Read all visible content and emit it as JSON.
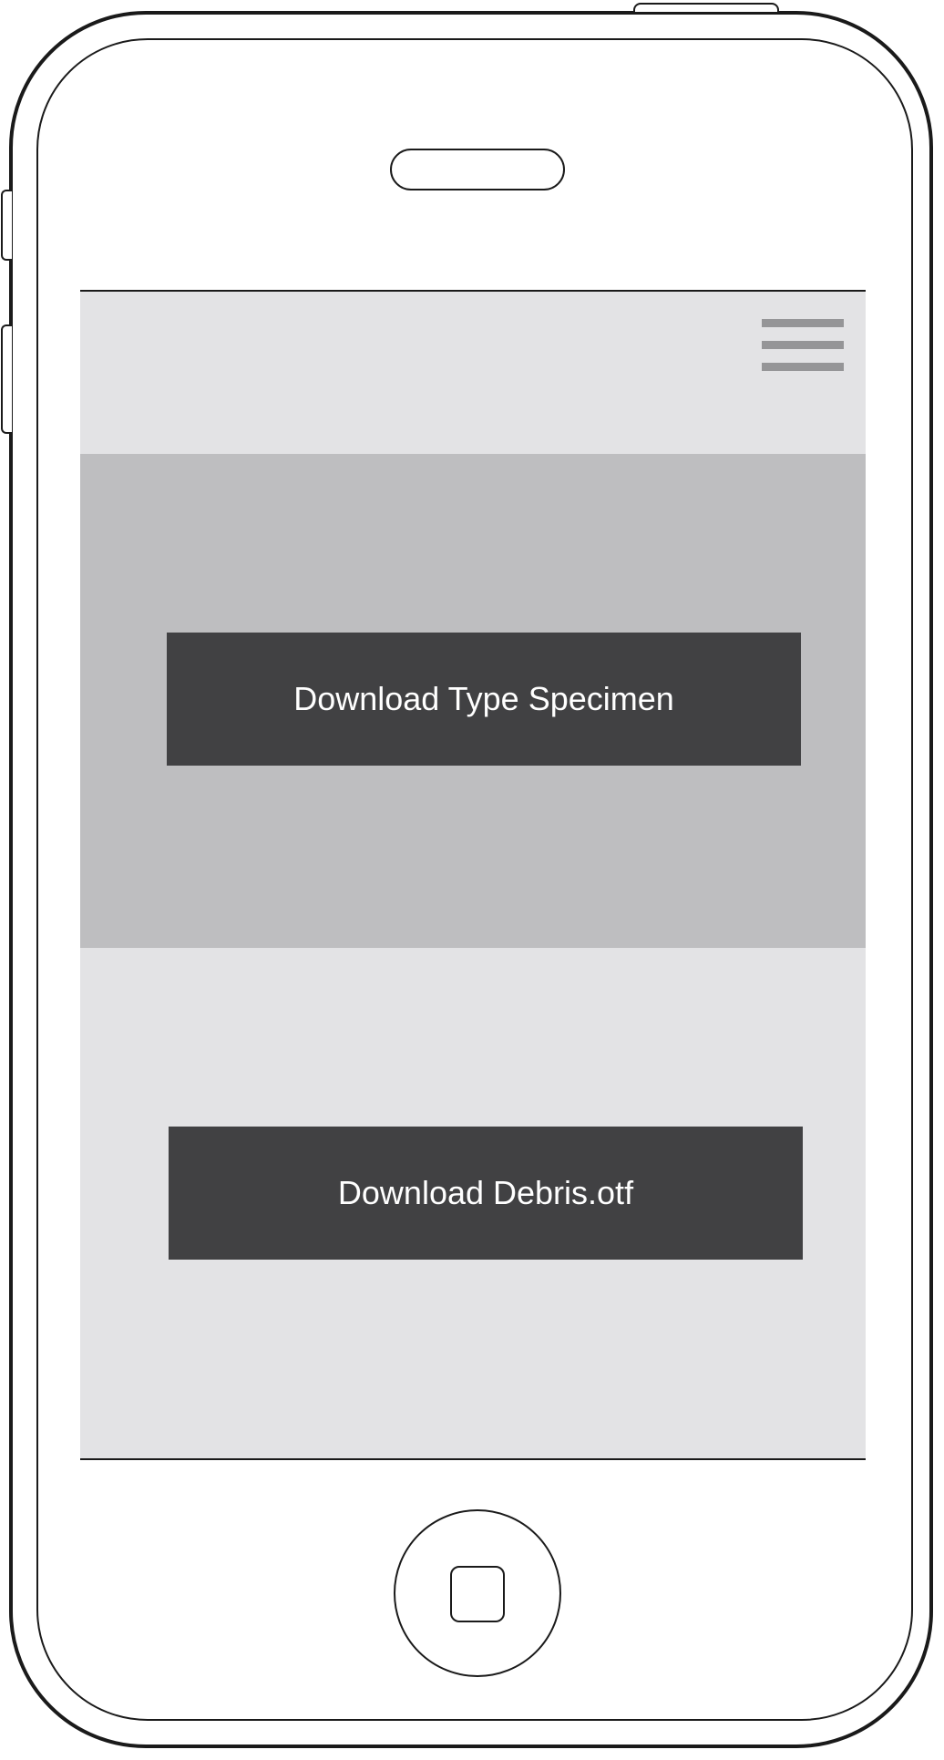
{
  "header": {
    "menu_icon": "hamburger-menu-icon"
  },
  "hero": {
    "specimen_button_label": "Download Type Specimen"
  },
  "lower": {
    "font_button_label": "Download Debris.otf"
  },
  "device": {
    "home_icon": "home-square-icon"
  },
  "colors": {
    "screen_background": "#e3e3e5",
    "hero_background": "#bebec0",
    "button_background": "#414143",
    "button_text": "#ffffff",
    "menu_bars": "#959597"
  }
}
